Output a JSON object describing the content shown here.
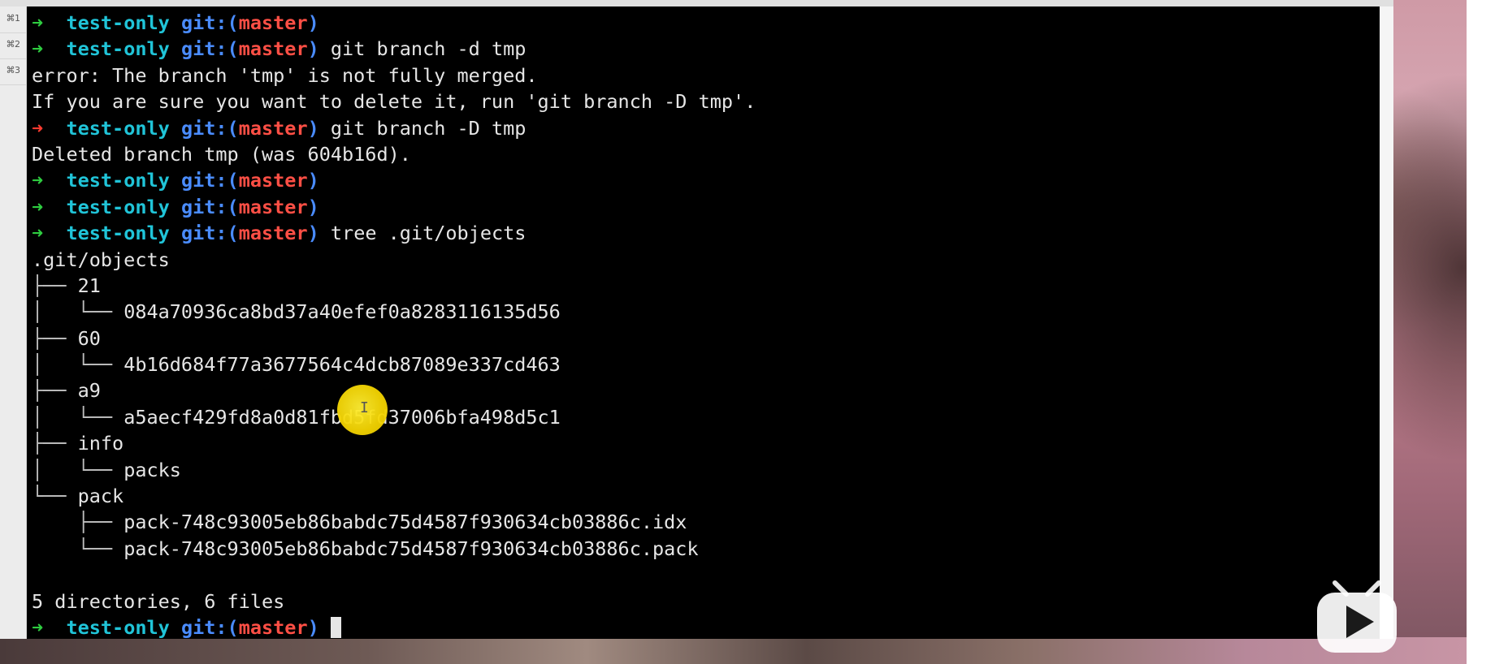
{
  "tabs": [
    {
      "label": "⌘1"
    },
    {
      "label": "⌘2"
    },
    {
      "label": "⌘3"
    }
  ],
  "prompt": {
    "dir": "test-only",
    "git_label": "git:",
    "open_paren": "(",
    "branch": "master",
    "close_paren": ")"
  },
  "terminal": {
    "lines": [
      {
        "kind": "prompt",
        "status": "ok",
        "cmd": ""
      },
      {
        "kind": "prompt",
        "status": "ok",
        "cmd": " git branch -d tmp"
      },
      {
        "kind": "out",
        "text": "error: The branch 'tmp' is not fully merged."
      },
      {
        "kind": "out",
        "text": "If you are sure you want to delete it, run 'git branch -D tmp'."
      },
      {
        "kind": "prompt",
        "status": "err",
        "cmd": " git branch -D tmp"
      },
      {
        "kind": "out",
        "text": "Deleted branch tmp (was 604b16d)."
      },
      {
        "kind": "prompt",
        "status": "ok",
        "cmd": ""
      },
      {
        "kind": "prompt",
        "status": "ok",
        "cmd": ""
      },
      {
        "kind": "prompt",
        "status": "ok",
        "cmd": " tree .git/objects"
      },
      {
        "kind": "out",
        "text": ".git/objects"
      },
      {
        "kind": "tree",
        "guide": "├── ",
        "text": "21"
      },
      {
        "kind": "tree",
        "guide": "│   └── ",
        "text": "084a70936ca8bd37a40efef0a8283116135d56"
      },
      {
        "kind": "tree",
        "guide": "├── ",
        "text": "60"
      },
      {
        "kind": "tree",
        "guide": "│   └── ",
        "text": "4b16d684f77a3677564c4dcb87089e337cd463"
      },
      {
        "kind": "tree",
        "guide": "├── ",
        "text": "a9"
      },
      {
        "kind": "tree",
        "guide": "│   └── ",
        "text": "a5aecf429fd8a0d81fbd5fd37006bfa498d5c1"
      },
      {
        "kind": "tree",
        "guide": "├── ",
        "text": "info"
      },
      {
        "kind": "tree",
        "guide": "│   └── ",
        "text": "packs"
      },
      {
        "kind": "tree",
        "guide": "└── ",
        "text": "pack"
      },
      {
        "kind": "tree",
        "guide": "    ├── ",
        "text": "pack-748c93005eb86babdc75d4587f930634cb03886c.idx"
      },
      {
        "kind": "tree",
        "guide": "    └── ",
        "text": "pack-748c93005eb86babdc75d4587f930634cb03886c.pack"
      },
      {
        "kind": "blank",
        "text": ""
      },
      {
        "kind": "out",
        "text": "5 directories, 6 files"
      },
      {
        "kind": "prompt-active",
        "status": "ok",
        "cmd": " "
      }
    ],
    "arrow_glyph": "➜",
    "arrow_ok_color": "#2ecc40",
    "arrow_err_color": "#ff3b30",
    "dir_color": "#20c4d8",
    "git_color": "#4a8cff",
    "branch_color": "#ff4f45"
  },
  "icons": {
    "mouse_highlight": "cursor-highlight-icon",
    "play_logo": "video-play-icon"
  }
}
